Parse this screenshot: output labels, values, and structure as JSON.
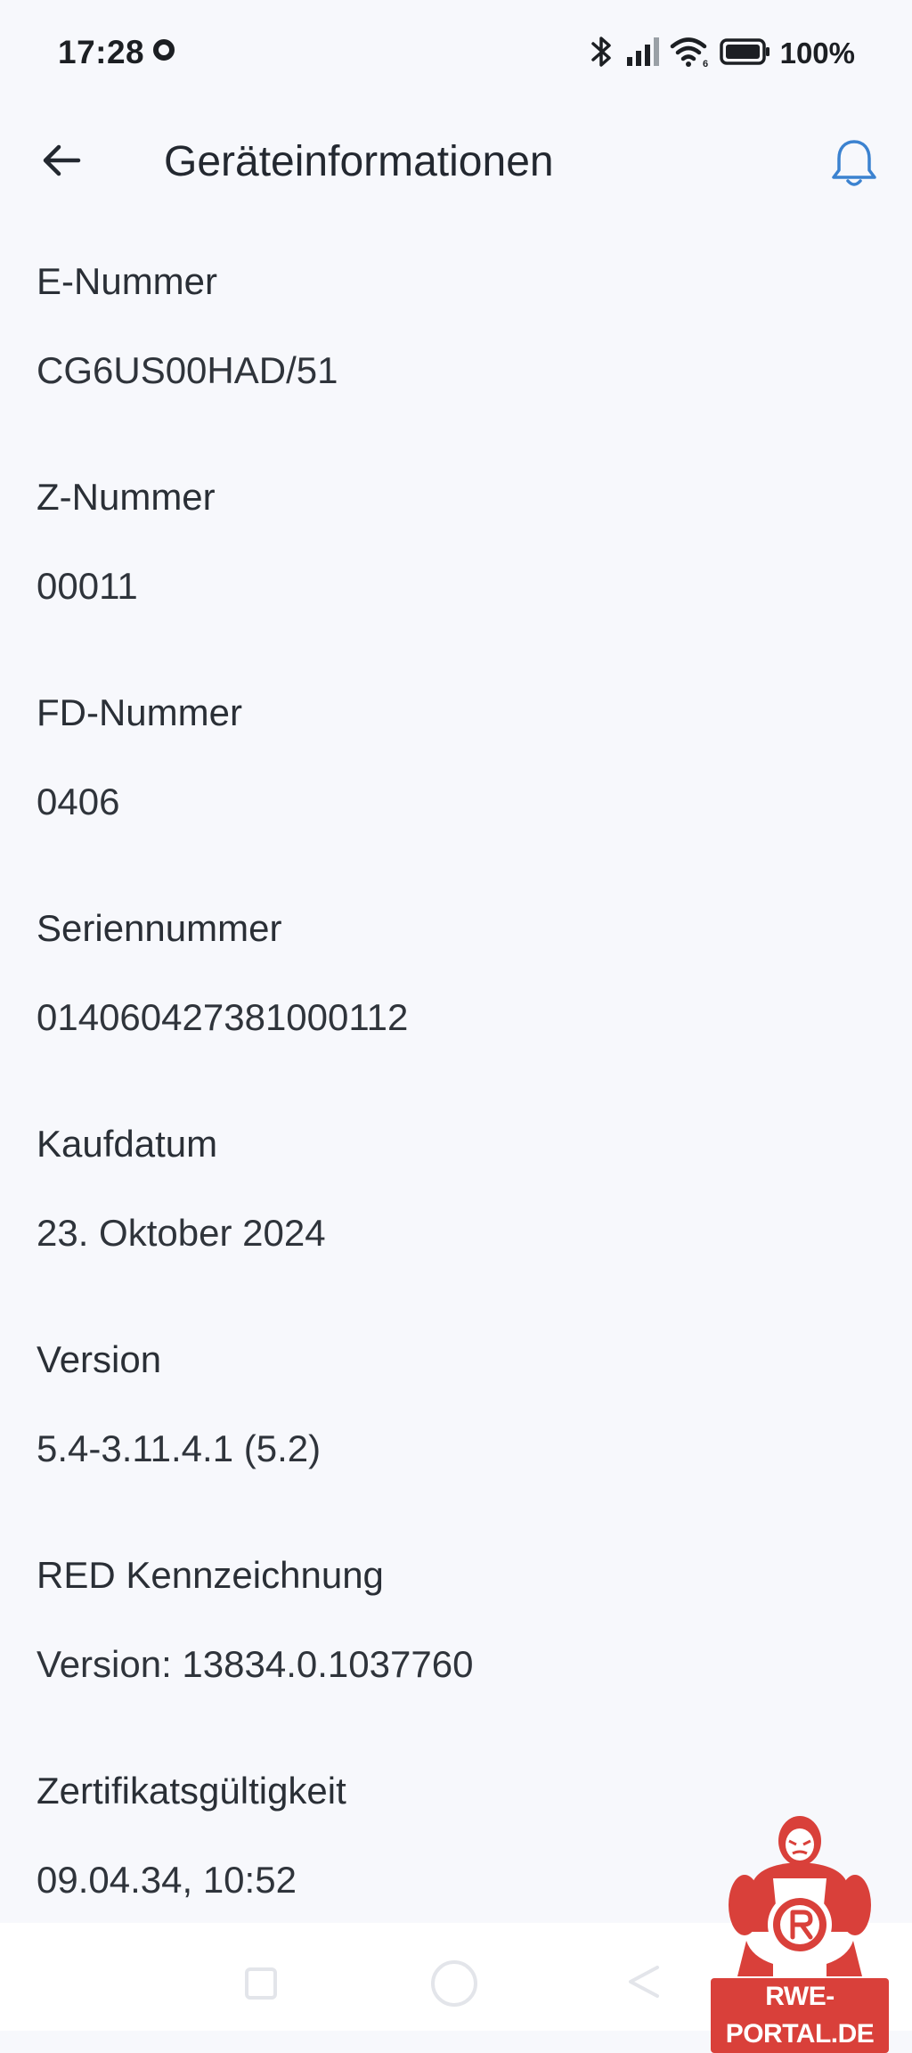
{
  "status_bar": {
    "time": "17:28",
    "battery": "100%"
  },
  "app_bar": {
    "title": "Geräteinformationen",
    "back_icon": "arrow-left-icon",
    "bell_icon": "bell-icon",
    "accent_color": "#3b82d0"
  },
  "info": [
    {
      "label": "E-Nummer",
      "value": "CG6US00HAD/51"
    },
    {
      "label": "Z-Nummer",
      "value": "00011"
    },
    {
      "label": "FD-Nummer",
      "value": "0406"
    },
    {
      "label": "Seriennummer",
      "value": "014060427381000112"
    },
    {
      "label": "Kaufdatum",
      "value": "23. Oktober 2024"
    },
    {
      "label": "Version",
      "value": "5.4-3.11.4.1 (5.2)"
    },
    {
      "label": "RED Kennzeichnung",
      "value": "Version: 13834.0.1037760"
    },
    {
      "label": "Zertifikatsgültigkeit",
      "value": "09.04.34, 10:52"
    }
  ],
  "watermark": {
    "text": "RWE-PORTAL.DE",
    "color": "#d9403a"
  }
}
